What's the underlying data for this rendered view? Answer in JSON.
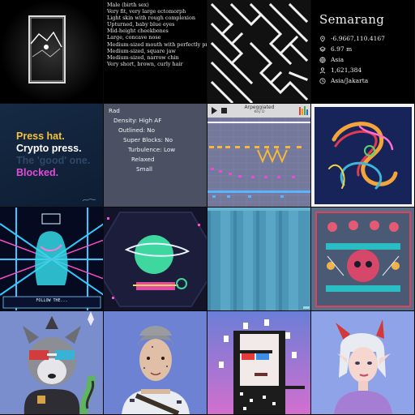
{
  "traits": [
    "Male (birth sex)",
    "Very fit, very large ectomorph",
    "Light skin with rough complexion",
    "Upturned, baby blue eyes",
    "Mid-height cheekbones",
    "Large, concave nose",
    "Medium-sized mouth with perfectly proportions",
    "Medium-sized, square jaw",
    "Medium-sized, narrow chin",
    "Very short, brown, curly hair"
  ],
  "city": {
    "name": "Semarang",
    "coords": "-6.9667,110.4167",
    "elevation": "6.97 m",
    "continent": "Asia",
    "population": "1,621,384",
    "timezone": "Asia/Jakarta"
  },
  "press": {
    "line1": "Press hat.",
    "line2": "Crypto press.",
    "line3": "The 'good' one.",
    "line4": "Blocked."
  },
  "rad": {
    "title": "Rad",
    "density": "Density: High AF",
    "outlined": "Outlined: No",
    "super_blocks": "Super Blocks: No",
    "turbulence": "Turbulence: Low",
    "relaxed": "Relaxed",
    "small": "Small"
  },
  "arp": {
    "title": "Arpeggiated",
    "key": "Key D"
  },
  "neon_caption": "FOLLOW THE...",
  "colors": {
    "press_yellow": "#f6c23c",
    "press_magenta": "#e14cd8",
    "rad_bg": "#4b5163",
    "city_bg": "#000000"
  }
}
